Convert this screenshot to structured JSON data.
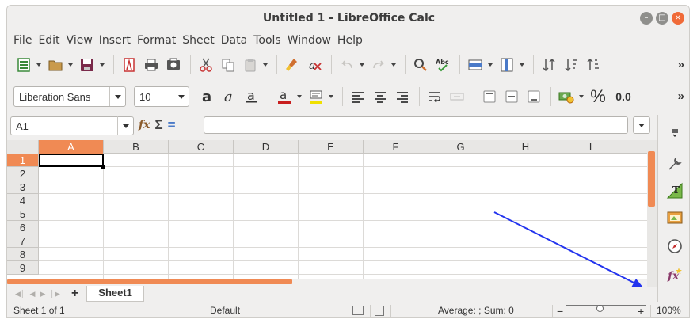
{
  "window": {
    "title": "Untitled 1 - LibreOffice Calc"
  },
  "window_buttons": {
    "minimize": "–",
    "maximize": "□",
    "close": "×"
  },
  "menu": [
    "File",
    "Edit",
    "View",
    "Insert",
    "Format",
    "Sheet",
    "Data",
    "Tools",
    "Window",
    "Help"
  ],
  "toolbar_more": "»",
  "format_toolbar": {
    "font_name": "Liberation Sans",
    "font_size": "10",
    "percent": "%",
    "decimal": "0.0"
  },
  "spell_label": "Abc",
  "formula_bar": {
    "name_box": "A1",
    "sum_symbol": "Σ",
    "equals_symbol": "=",
    "function_icon": "fx"
  },
  "columns": [
    "A",
    "B",
    "C",
    "D",
    "E",
    "F",
    "G",
    "H",
    "I"
  ],
  "rows": [
    "1",
    "2",
    "3",
    "4",
    "5",
    "6",
    "7",
    "8",
    "9"
  ],
  "selected_cell": "A1",
  "sheet_tabs": [
    "Sheet1"
  ],
  "add_sheet_symbol": "+",
  "status": {
    "sheet_info": "Sheet 1 of 1",
    "page_style": "Default",
    "selection_stats": "Average: ; Sum: 0",
    "zoom_minus": "−",
    "zoom_plus": "+",
    "zoom": "100%"
  },
  "colors": {
    "accent": "#f08a54",
    "close_button": "#f06a38",
    "annotation_arrow": "#2233ee"
  }
}
